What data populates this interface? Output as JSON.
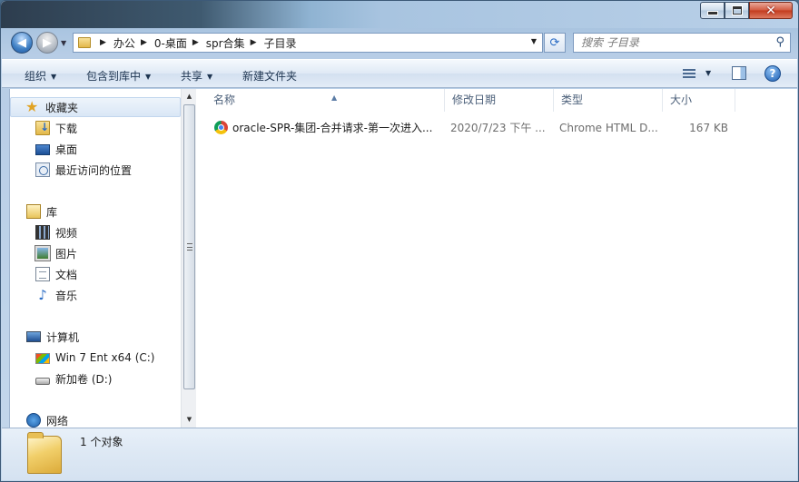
{
  "title_bar": {
    "buttons": {
      "minimize": "minimize-icon",
      "maximize": "maximize-icon",
      "close": "close-icon"
    }
  },
  "nav": {
    "breadcrumb": [
      "办公",
      "0-桌面",
      "spr合集",
      "子目录"
    ],
    "search_placeholder": "搜索 子目录"
  },
  "toolbar": {
    "organize": "组织",
    "include_in_library": "包含到库中",
    "share": "共享",
    "new_folder": "新建文件夹"
  },
  "sidebar": {
    "favorites": {
      "label": "收藏夹",
      "items": [
        {
          "label": "下载",
          "icon": "download-folder-icon"
        },
        {
          "label": "桌面",
          "icon": "desktop-icon"
        },
        {
          "label": "最近访问的位置",
          "icon": "recent-places-icon"
        }
      ]
    },
    "libraries": {
      "label": "库",
      "items": [
        {
          "label": "视频",
          "icon": "video-icon"
        },
        {
          "label": "图片",
          "icon": "picture-icon"
        },
        {
          "label": "文档",
          "icon": "document-icon"
        },
        {
          "label": "音乐",
          "icon": "music-icon"
        }
      ]
    },
    "computer": {
      "label": "计算机",
      "items": [
        {
          "label": "Win 7 Ent x64 (C:)",
          "icon": "windows-drive-icon"
        },
        {
          "label": "新加卷 (D:)",
          "icon": "drive-icon"
        }
      ]
    },
    "network": {
      "label": "网络"
    }
  },
  "file_list": {
    "columns": [
      "名称",
      "修改日期",
      "类型",
      "大小"
    ],
    "rows": [
      {
        "name": "oracle-SPR-集团-合并请求-第一次进入...",
        "modified": "2020/7/23 下午 ...",
        "type": "Chrome HTML D...",
        "size": "167 KB",
        "icon": "chrome-icon"
      }
    ]
  },
  "details": {
    "text": "1 个对象"
  }
}
